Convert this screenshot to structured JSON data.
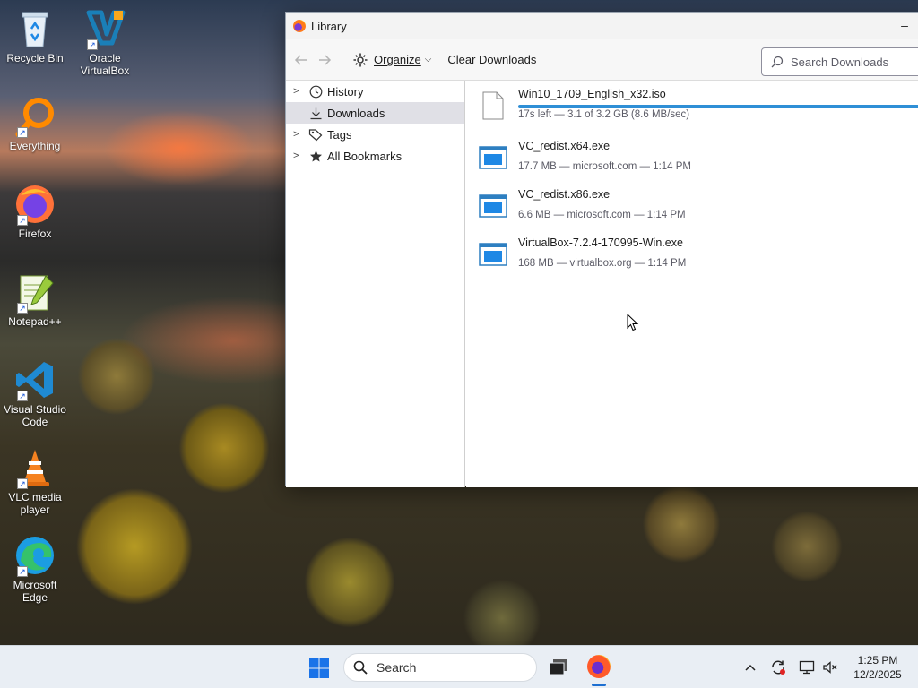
{
  "desktop": {
    "icons": [
      {
        "label": "Recycle Bin"
      },
      {
        "label": "Oracle VirtualBox"
      },
      {
        "label": "Everything"
      },
      {
        "label": "Firefox"
      },
      {
        "label": "Notepad++"
      },
      {
        "label": "Visual Studio Code"
      },
      {
        "label": "VLC media player"
      },
      {
        "label": "Microsoft Edge"
      }
    ]
  },
  "window": {
    "title": "Library",
    "toolbar": {
      "organize_label": "Organize",
      "clear_label": "Clear Downloads",
      "search_placeholder": "Search Downloads"
    },
    "sidebar": {
      "items": [
        {
          "label": "History",
          "icon": "clock-icon",
          "expandable": true
        },
        {
          "label": "Downloads",
          "icon": "download-icon",
          "expandable": false,
          "selected": true
        },
        {
          "label": "Tags",
          "icon": "tag-icon",
          "expandable": true
        },
        {
          "label": "All Bookmarks",
          "icon": "star-icon",
          "expandable": true
        }
      ]
    },
    "downloads": [
      {
        "name": "Win10_1709_English_x32.iso",
        "status": "17s left — 3.1 of 3.2 GB (8.6 MB/sec)",
        "icon": "file-icon",
        "progress": 0.97
      },
      {
        "name": "VC_redist.x64.exe",
        "status": "17.7 MB — microsoft.com — 1:14 PM",
        "icon": "exe-icon"
      },
      {
        "name": "VC_redist.x86.exe",
        "status": "6.6 MB — microsoft.com — 1:14 PM",
        "icon": "exe-icon"
      },
      {
        "name": "VirtualBox-7.2.4-170995-Win.exe",
        "status": "168 MB — virtualbox.org — 1:14 PM",
        "icon": "exe-icon"
      }
    ]
  },
  "taskbar": {
    "search_label": "Search",
    "time": "1:25 PM",
    "date": "12/2/2025"
  },
  "colors": {
    "accent": "#2f8fd6",
    "taskbar_bg": "#e9eef4"
  }
}
